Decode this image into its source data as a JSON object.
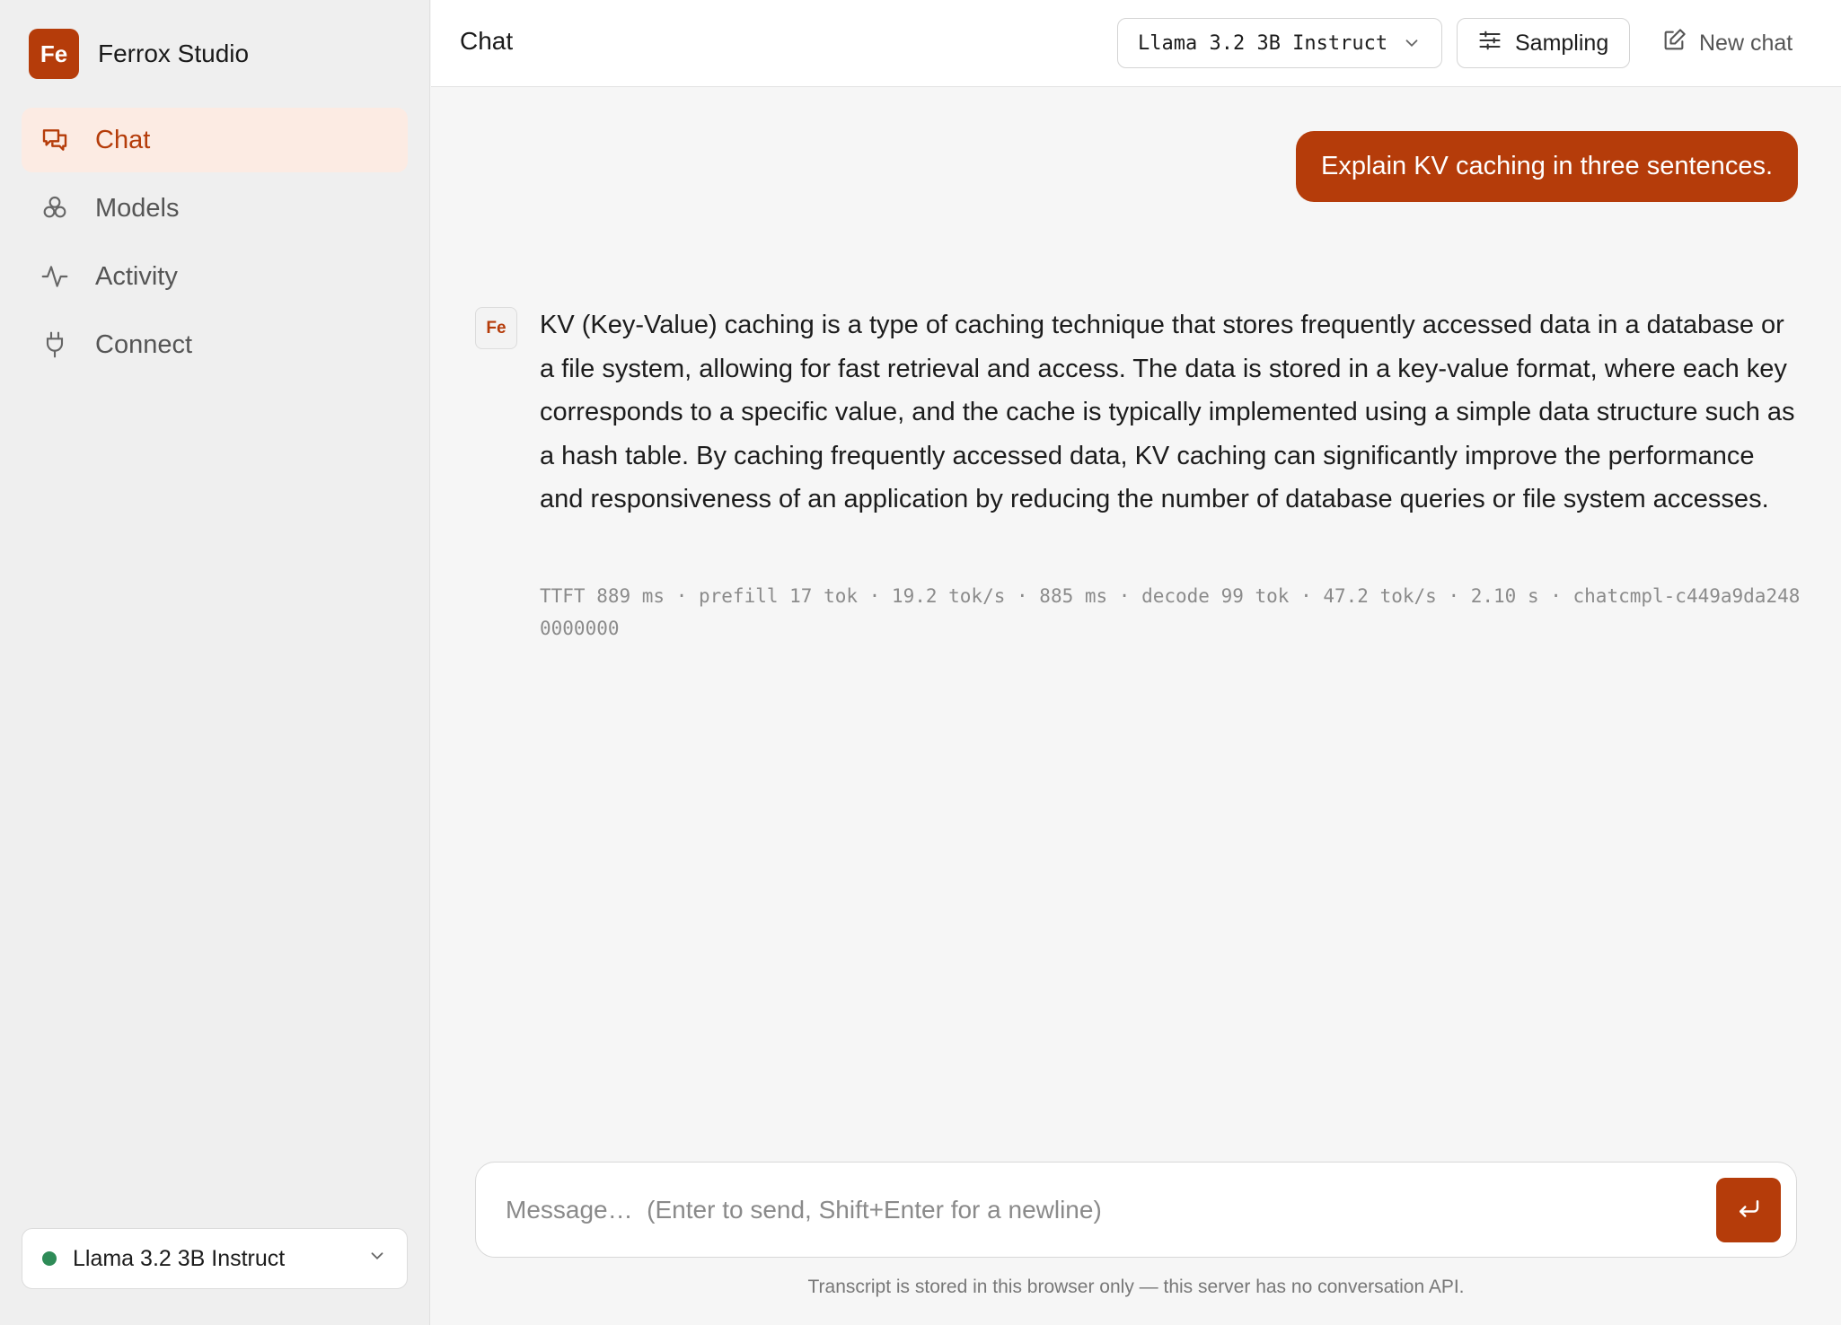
{
  "brand": {
    "logo_text": "Fe",
    "name": "Ferrox Studio"
  },
  "sidebar": {
    "items": [
      {
        "label": "Chat",
        "icon": "chat-bubbles-icon",
        "active": true
      },
      {
        "label": "Models",
        "icon": "cubes-icon",
        "active": false
      },
      {
        "label": "Activity",
        "icon": "activity-pulse-icon",
        "active": false
      },
      {
        "label": "Connect",
        "icon": "plug-icon",
        "active": false
      }
    ],
    "model_selector": {
      "label": "Llama 3.2 3B Instruct",
      "status": "online",
      "status_color": "#2e8b57"
    }
  },
  "header": {
    "title": "Chat",
    "model_dropdown": "Llama 3.2 3B Instruct",
    "sampling_label": "Sampling",
    "new_chat_label": "New chat"
  },
  "conversation": {
    "user_message": "Explain KV caching in three sentences.",
    "assistant": {
      "avatar": "Fe",
      "text": "KV (Key-Value) caching is a type of caching technique that stores frequently accessed data in a database or a file system, allowing for fast retrieval and access. The data is stored in a key-value format, where each key corresponds to a specific value, and the cache is typically implemented using a simple data structure such as a hash table. By caching frequently accessed data, KV caching can significantly improve the performance and responsiveness of an application by reducing the number of database queries or file system accesses.",
      "meta": "TTFT 889 ms · prefill 17 tok · 19.2 tok/s · 885 ms · decode 99 tok · 47.2 tok/s · 2.10 s · chatcmpl-c449a9da2480000000"
    }
  },
  "composer": {
    "placeholder": "Message…  (Enter to send, Shift+Enter for a newline)",
    "value": ""
  },
  "footer": {
    "note": "Transcript is stored in this browser only — this server has no conversation API."
  },
  "colors": {
    "accent": "#b53c0a",
    "accent_soft": "#fcebe3",
    "sidebar_bg": "#efefef",
    "main_bg": "#f6f6f6"
  }
}
